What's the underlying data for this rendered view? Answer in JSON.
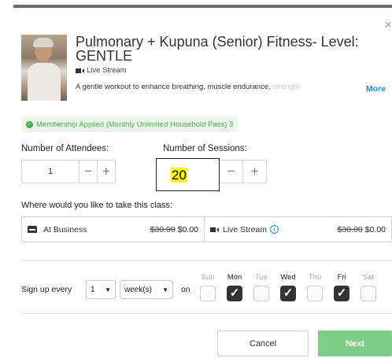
{
  "class": {
    "title": "Pulmonary + Kupuna (Senior) Fitness- Level: GENTLE",
    "format": "Live Stream",
    "description": "A gentle workout to enhance breathing, muscle endurance, ",
    "description_faded": "strength",
    "more_label": "More",
    "close_label": "×"
  },
  "membership": {
    "text": "Membership Applied (Monthly Unlimited Household Pass) 3"
  },
  "attendees": {
    "label": "Number of Attendees:",
    "value": "1",
    "minus": "−",
    "plus": "+"
  },
  "sessions": {
    "label": "Number of Sessions:",
    "value": "20",
    "minus": "−",
    "plus": "+"
  },
  "location": {
    "question": "Where would you like to take this class:",
    "options": [
      {
        "label": "At Business",
        "original_price": "$30.00",
        "price": "$0.00",
        "icon": "store-icon"
      },
      {
        "label": "Live Stream",
        "original_price": "$30.00",
        "price": "$0.00",
        "icon": "video-camera-icon",
        "info": "i"
      }
    ]
  },
  "schedule": {
    "signup_label": "Sign up every",
    "interval": "1",
    "unit": "week(s)",
    "on_label": "on",
    "days": [
      {
        "label": "Sun",
        "checked": false
      },
      {
        "label": "Mon",
        "checked": true
      },
      {
        "label": "Tue",
        "checked": false
      },
      {
        "label": "Wed",
        "checked": true
      },
      {
        "label": "Thu",
        "checked": false
      },
      {
        "label": "Fri",
        "checked": true
      },
      {
        "label": "Sat",
        "checked": false
      }
    ],
    "check_glyph": "✓"
  },
  "actions": {
    "cancel": "Cancel",
    "next": "Next"
  },
  "colors": {
    "accent": "#1a8cd8",
    "success": "#4cae4c",
    "next_button": "#7dcd86",
    "highlight": "#ffff00"
  }
}
